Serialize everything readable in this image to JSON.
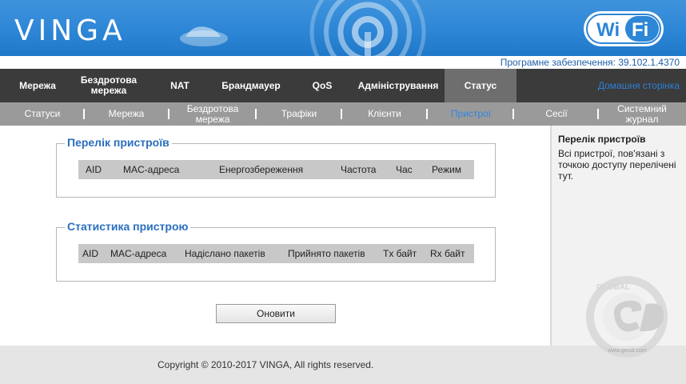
{
  "header": {
    "logo": "VINGA",
    "wifi_badge": "WiFi",
    "version_label": "Програмне забезпечення: 39.102.1.4370"
  },
  "nav": {
    "items": [
      {
        "label": "Мережа"
      },
      {
        "label": "Бездротова мережа"
      },
      {
        "label": "NAT"
      },
      {
        "label": "Брандмауер"
      },
      {
        "label": "QoS"
      },
      {
        "label": "Адміністрування"
      },
      {
        "label": "Статус"
      }
    ],
    "active": "Статус",
    "home_link": "Домашня сторінка"
  },
  "subnav": {
    "items": [
      {
        "label": "Статуси"
      },
      {
        "label": "Мережа"
      },
      {
        "label": "Бездротова мережа"
      },
      {
        "label": "Трафіки"
      },
      {
        "label": "Клієнти"
      },
      {
        "label": "Пристрої"
      },
      {
        "label": "Сесії"
      },
      {
        "label": "Системний журнал"
      }
    ],
    "active": "Пристрої"
  },
  "device_list": {
    "title": "Перелік пристроїв",
    "columns": [
      "AID",
      "MAC-адреса",
      "Енергозбереження",
      "Частота",
      "Час",
      "Режим"
    ]
  },
  "device_stats": {
    "title": "Статистика пристрою",
    "columns": [
      "AID",
      "MAC-адреса",
      "Надіслано пакетів",
      "Прийнято пакетів",
      "Tx байт",
      "Rx байт"
    ]
  },
  "refresh_button": "Оновити",
  "sidebar": {
    "title": "Перелік пристроїв",
    "text": "Всі пристрої, пов'язані з точкою доступу перелічені тут."
  },
  "footer": {
    "copyright": "Copyright © 2010-2017 VINGA, All rights reserved."
  },
  "watermark": {
    "top": "GLOBAL",
    "site": "www.gecid.com"
  },
  "colors": {
    "banner": "#2d86d6",
    "nav_bg": "#3b3b3b",
    "nav_active": "#6e6e6e",
    "subnav_bg": "#9a9a9a",
    "accent": "#2f86e0"
  }
}
